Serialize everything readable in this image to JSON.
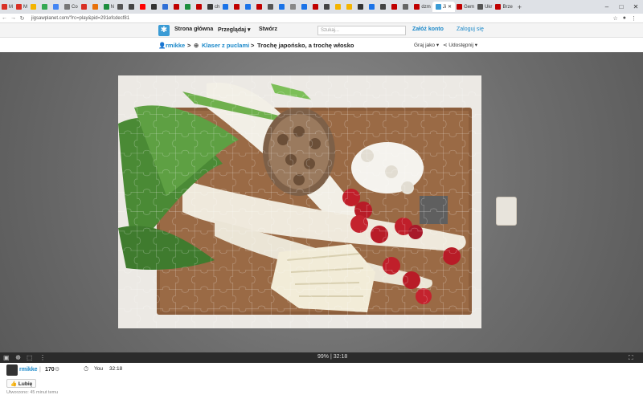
{
  "browser": {
    "tabs": [
      {
        "icon": "gmail-icon",
        "color": "#d93025",
        "label": "M"
      },
      {
        "icon": "gmail-icon",
        "color": "#d93025",
        "label": "M"
      },
      {
        "icon": "keep-icon",
        "color": "#f4b400",
        "label": ""
      },
      {
        "icon": "maps-icon",
        "color": "#34a853",
        "label": ""
      },
      {
        "icon": "google-icon",
        "color": "#4285f4",
        "label": ""
      },
      {
        "icon": "page-icon",
        "color": "#777777",
        "label": "Co"
      },
      {
        "icon": "page-icon",
        "color": "#d93025",
        "label": ""
      },
      {
        "icon": "page-icon",
        "color": "#e8710a",
        "label": ""
      },
      {
        "icon": "page-icon",
        "color": "#1e8e3e",
        "label": "N"
      },
      {
        "icon": "page-icon",
        "color": "#555555",
        "label": ""
      },
      {
        "icon": "page-icon",
        "color": "#444444",
        "label": ""
      },
      {
        "icon": "youtube-icon",
        "color": "#ff0000",
        "label": ""
      },
      {
        "icon": "page-icon",
        "color": "#333333",
        "label": ""
      },
      {
        "icon": "page-icon",
        "color": "#2f6fd6",
        "label": ""
      },
      {
        "icon": "page-icon",
        "color": "#c00000",
        "label": ""
      },
      {
        "icon": "page-icon",
        "color": "#1e8e3e",
        "label": ""
      },
      {
        "icon": "page-icon",
        "color": "#c00000",
        "label": ""
      },
      {
        "icon": "page-icon",
        "color": "#3a3a3a",
        "label": "ch"
      },
      {
        "icon": "page-icon",
        "color": "#1a73e8",
        "label": ""
      },
      {
        "icon": "page-icon",
        "color": "#c00000",
        "label": ""
      },
      {
        "icon": "page-icon",
        "color": "#1a73e8",
        "label": ""
      },
      {
        "icon": "page-icon",
        "color": "#c00000",
        "label": ""
      },
      {
        "icon": "page-icon",
        "color": "#555555",
        "label": ""
      },
      {
        "icon": "page-icon",
        "color": "#1a73e8",
        "label": ""
      },
      {
        "icon": "page-icon",
        "color": "#888888",
        "label": ""
      },
      {
        "icon": "page-icon",
        "color": "#1a73e8",
        "label": ""
      },
      {
        "icon": "page-icon",
        "color": "#c00000",
        "label": ""
      },
      {
        "icon": "page-icon",
        "color": "#444444",
        "label": ""
      },
      {
        "icon": "page-icon",
        "color": "#f4b400",
        "label": ""
      },
      {
        "icon": "page-icon",
        "color": "#f4b400",
        "label": ""
      },
      {
        "icon": "page-icon",
        "color": "#333333",
        "label": ""
      },
      {
        "icon": "page-icon",
        "color": "#1a73e8",
        "label": ""
      },
      {
        "icon": "page-icon",
        "color": "#444444",
        "label": ""
      },
      {
        "icon": "page-icon",
        "color": "#c00000",
        "label": ""
      },
      {
        "icon": "page-icon",
        "color": "#666666",
        "label": ""
      },
      {
        "icon": "page-icon",
        "color": "#c00000",
        "label": "dzm"
      }
    ],
    "active_tab": {
      "icon": "jigsawplanet-icon",
      "color": "#3a9bd5",
      "label": "Ji"
    },
    "more_tabs": [
      {
        "icon": "page-icon",
        "color": "#c00000",
        "label": "Gem"
      },
      {
        "icon": "wikipedia-icon",
        "color": "#555555",
        "label": "Ukr"
      },
      {
        "icon": "page-icon",
        "color": "#c00000",
        "label": "Brze"
      }
    ],
    "url": "jigsawplanet.com/?rc=play&pid=291efcdecf81"
  },
  "site": {
    "nav_home": "Strona główna",
    "nav_browse": "Przeglądaj",
    "nav_create": "Stwórz",
    "search_placeholder": "Szukaj...",
    "register": "Załóż konto",
    "login": "Zaloguj się"
  },
  "breadcrumb": {
    "user": "rmikke",
    "folder": "Klaser z puclami",
    "title": "Trochę japońsko, a trochę włosko",
    "play_as": "Graj jako",
    "share": "Udostępnij"
  },
  "status": {
    "progress_text": "99%",
    "divider": "|",
    "time": "32:18",
    "completion": 0.99
  },
  "info": {
    "user": "rmikke",
    "sep": "|",
    "score": "170",
    "you_label": "You",
    "you_time": "32:18",
    "like_label": "Lubię",
    "created": "Utworzono: 45 minut temu"
  },
  "colors": {
    "brand": "#3a9bd5",
    "link": "#1a88c9",
    "statusbar": "#2b2b2b"
  }
}
